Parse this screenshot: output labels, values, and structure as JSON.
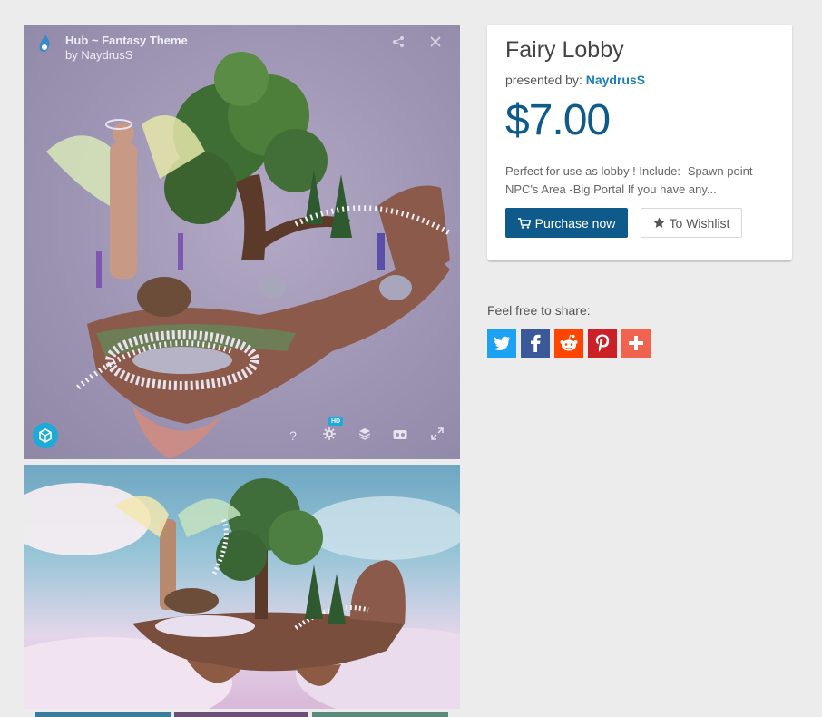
{
  "viewer": {
    "title": "Hub ~ Fantasy Theme",
    "author": "by NaydrusS",
    "hd_badge": "HD",
    "icons": [
      "share-icon",
      "close-icon",
      "help-icon",
      "settings-icon",
      "layers-icon",
      "vr-icon",
      "fullscreen-icon"
    ]
  },
  "product": {
    "name": "Fairy Lobby",
    "presented_by_label": "presented by:",
    "seller": "NaydrusS",
    "price": "$7.00",
    "description": "Perfect for use as lobby ! Include: -Spawn point -NPC's Area -Big Portal If you have any...",
    "purchase_label": "Purchase now",
    "wishlist_label": "To Wishlist"
  },
  "share": {
    "label": "Feel free to share:",
    "networks": [
      {
        "name": "twitter",
        "color": "#1da1f2"
      },
      {
        "name": "facebook",
        "color": "#3b5998"
      },
      {
        "name": "reddit",
        "color": "#ff4500"
      },
      {
        "name": "pinterest",
        "color": "#cb2027"
      },
      {
        "name": "more",
        "color": "#f0644f"
      }
    ]
  },
  "colors": {
    "accent": "#0e5a8a",
    "seller_link": "#1c7fb6",
    "sketchfab": "#1caad9"
  }
}
